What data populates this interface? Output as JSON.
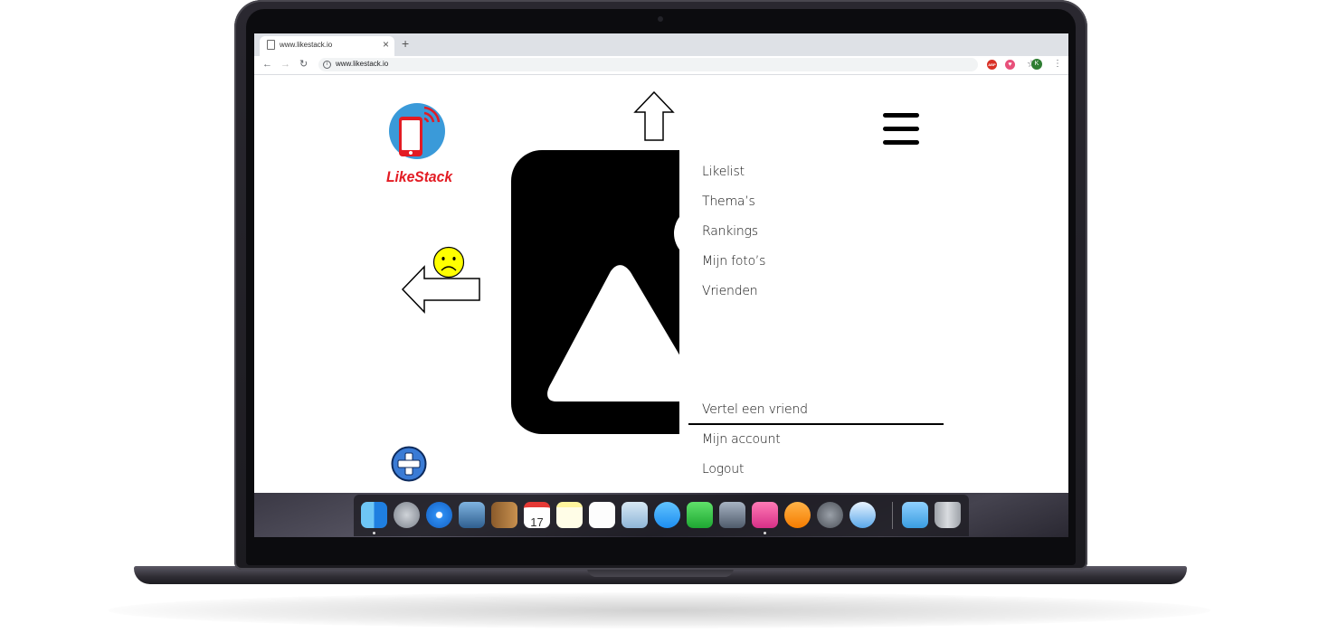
{
  "browser": {
    "tab_title": "www.likestack.io",
    "url": "www.likestack.io",
    "profile_initial": "K",
    "extension_abp": "ABP",
    "icons": [
      "page-icon",
      "close-icon",
      "plus-icon",
      "back-arrow-icon",
      "forward-arrow-icon",
      "reload-icon",
      "info-icon",
      "star-icon",
      "adblock-icon",
      "extension-icon",
      "profile-avatar",
      "menu-dots-icon"
    ]
  },
  "app": {
    "logo_text": "LikeStack",
    "colors": {
      "logo_red": "#e31b23",
      "logo_blue": "#3a9ad9",
      "sad_face": "#ffff00",
      "add_button": "#3a7bd5"
    }
  },
  "menu": {
    "items": [
      {
        "label": "Likelist"
      },
      {
        "label": "Thema’s"
      },
      {
        "label": "Rankings"
      },
      {
        "label": "Mijn foto’s"
      },
      {
        "label": "Vrienden"
      }
    ],
    "bottom_items": [
      {
        "label": "Vertel een vriend"
      },
      {
        "label": "Mijn account"
      },
      {
        "label": "Logout"
      }
    ]
  },
  "dock": {
    "apps": [
      "finder-icon",
      "launchpad-icon",
      "safari-icon",
      "preview-icon",
      "contacts-icon",
      "calendar-icon",
      "notes-icon",
      "reminders-icon",
      "photo-booth-icon",
      "messages-icon",
      "facetime-icon",
      "image-capture-icon",
      "keynote-icon",
      "books-icon",
      "system-preferences-icon",
      "xcode-icon",
      "downloads-folder-icon",
      "trash-icon"
    ],
    "calendar_day": "17"
  }
}
